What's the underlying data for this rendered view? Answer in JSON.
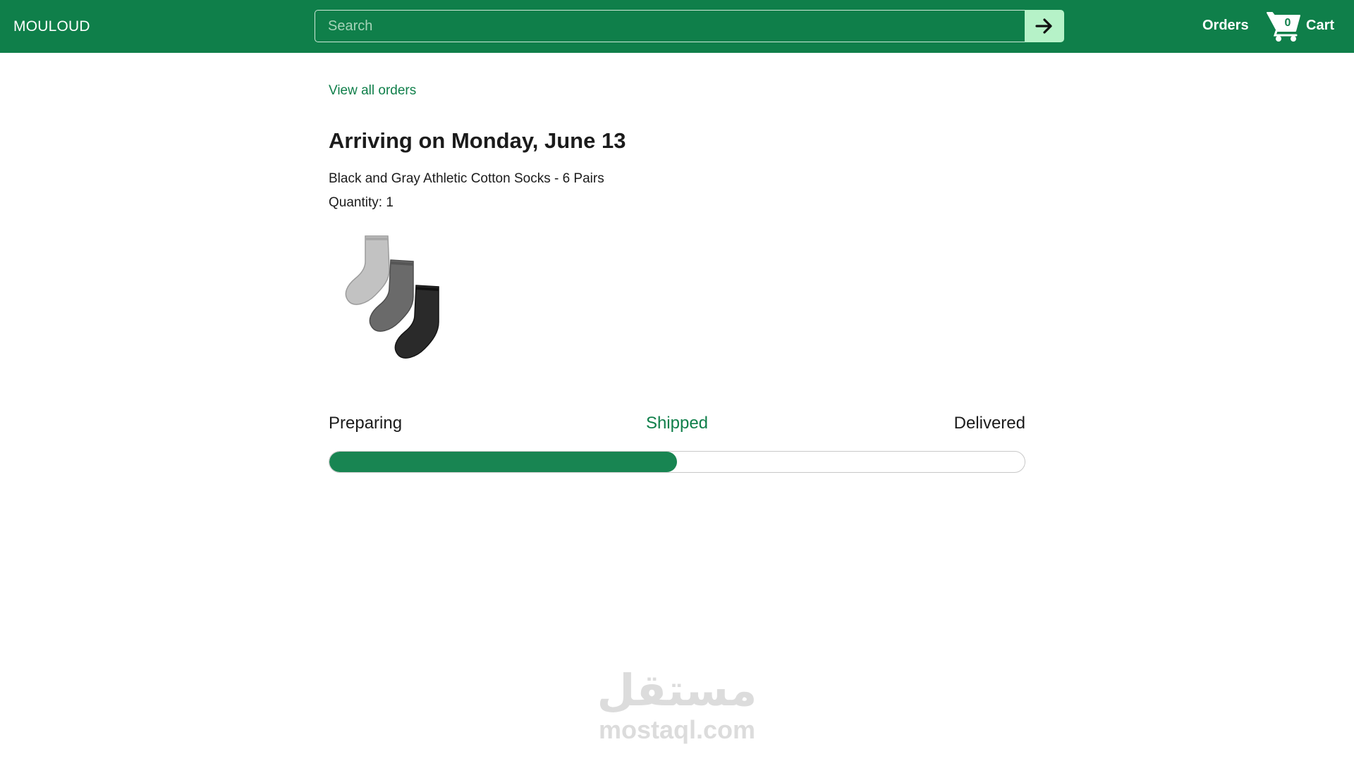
{
  "header": {
    "brand": "MOULOUD",
    "search": {
      "placeholder": "Search",
      "value": ""
    },
    "search_button_icon": "arrow-right-icon",
    "orders_label": "Orders",
    "cart": {
      "icon": "cart-icon",
      "count": "0",
      "label": "Cart"
    }
  },
  "main": {
    "view_all_orders": "View all orders",
    "arrival_title": "Arriving on Monday, June 13",
    "product_name": "Black and Gray Athletic Cotton Socks - 6 Pairs",
    "quantity": "Quantity: 1",
    "product_image_icon": "socks-image",
    "progress": {
      "steps": [
        "Preparing",
        "Shipped",
        "Delivered"
      ],
      "current_step": "Shipped",
      "fraction": 0.5
    }
  },
  "watermark": {
    "arabic": "مستقل",
    "latin": "mostaql.com"
  },
  "colors": {
    "brand_green": "#0f7f4a",
    "progress_green": "#188552",
    "search_button_bg": "#b6f2c8",
    "watermark_gray": "#dcdcdc"
  }
}
